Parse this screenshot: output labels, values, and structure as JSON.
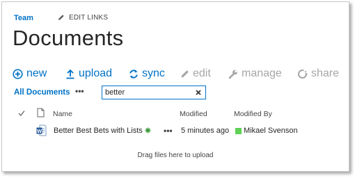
{
  "site": {
    "team_link": "Team",
    "edit_links": "EDIT LINKS"
  },
  "page": {
    "title": "Documents"
  },
  "commands": [
    {
      "label": "new",
      "icon": "plus-circle-icon",
      "enabled": true
    },
    {
      "label": "upload",
      "icon": "upload-icon",
      "enabled": true
    },
    {
      "label": "sync",
      "icon": "sync-icon",
      "enabled": true
    },
    {
      "label": "edit",
      "icon": "pencil-icon",
      "enabled": false
    },
    {
      "label": "manage",
      "icon": "wrench-icon",
      "enabled": false
    },
    {
      "label": "share",
      "icon": "share-icon",
      "enabled": false
    }
  ],
  "views": {
    "current": "All Documents",
    "more": "•••"
  },
  "search": {
    "value": "better"
  },
  "columns": {
    "name": "Name",
    "modified": "Modified",
    "modified_by": "Modified By"
  },
  "rows": [
    {
      "name": "Better Best Bets with Lists",
      "file_type_icon": "word-document-icon",
      "is_new": true,
      "more": "•••",
      "modified": "5 minutes ago",
      "modified_by": "Mikael Svenson",
      "presence": "available"
    }
  ],
  "drop_hint": "Drag files here to upload",
  "colors": {
    "accent": "#0072c6",
    "disabled": "#a6a6a6",
    "text": "#262626",
    "presence_available": "#5dd255",
    "new_badge": "#3c9a3c"
  }
}
